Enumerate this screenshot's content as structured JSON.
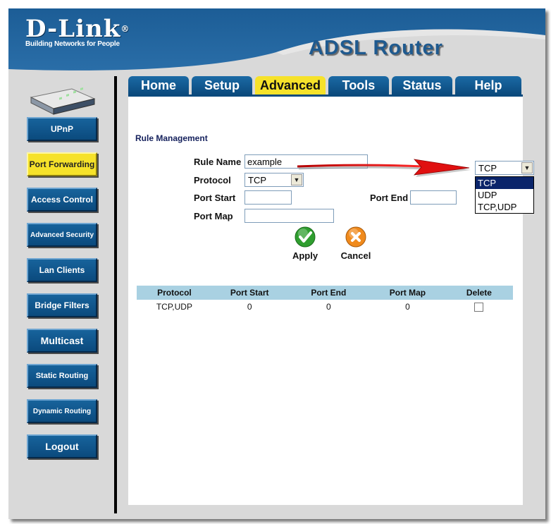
{
  "brand": {
    "name": "D-Link",
    "tagline": "Building Networks for People",
    "registered": "®"
  },
  "product": "ADSL Router",
  "tabs": [
    {
      "label": "Home"
    },
    {
      "label": "Setup"
    },
    {
      "label": "Advanced"
    },
    {
      "label": "Tools"
    },
    {
      "label": "Status"
    },
    {
      "label": "Help"
    }
  ],
  "sidebar": {
    "items": [
      {
        "label": "UPnP"
      },
      {
        "label": "Port Forwarding"
      },
      {
        "label": "Access Control"
      },
      {
        "label": "Advanced Security"
      },
      {
        "label": "Lan Clients"
      },
      {
        "label": "Bridge Filters"
      },
      {
        "label": "Multicast"
      },
      {
        "label": "Static Routing"
      },
      {
        "label": "Dynamic Routing"
      },
      {
        "label": "Logout"
      }
    ]
  },
  "form": {
    "section_title": "Rule Management",
    "rule_name_label": "Rule Name",
    "rule_name_value": "example",
    "protocol_label": "Protocol",
    "protocol_value": "TCP",
    "port_start_label": "Port Start",
    "port_start_value": "",
    "port_end_label": "Port End",
    "port_end_value": "",
    "port_map_label": "Port Map",
    "port_map_value": ""
  },
  "actions": {
    "apply": "Apply",
    "cancel": "Cancel"
  },
  "dropdown": {
    "selected": "TCP",
    "options": [
      "TCP",
      "UDP",
      "TCP,UDP"
    ]
  },
  "table": {
    "headers": [
      "Protocol",
      "Port Start",
      "Port End",
      "Port Map",
      "Delete"
    ],
    "rows": [
      {
        "protocol": "TCP,UDP",
        "port_start": "0",
        "port_end": "0",
        "port_map": "0"
      }
    ]
  },
  "colors": {
    "nav_blue": "#0b4a7d",
    "active_yellow": "#f6e22a",
    "header_blue": "#1d5a92",
    "table_header": "#a9d1e2",
    "arrow_red": "#e01010"
  }
}
